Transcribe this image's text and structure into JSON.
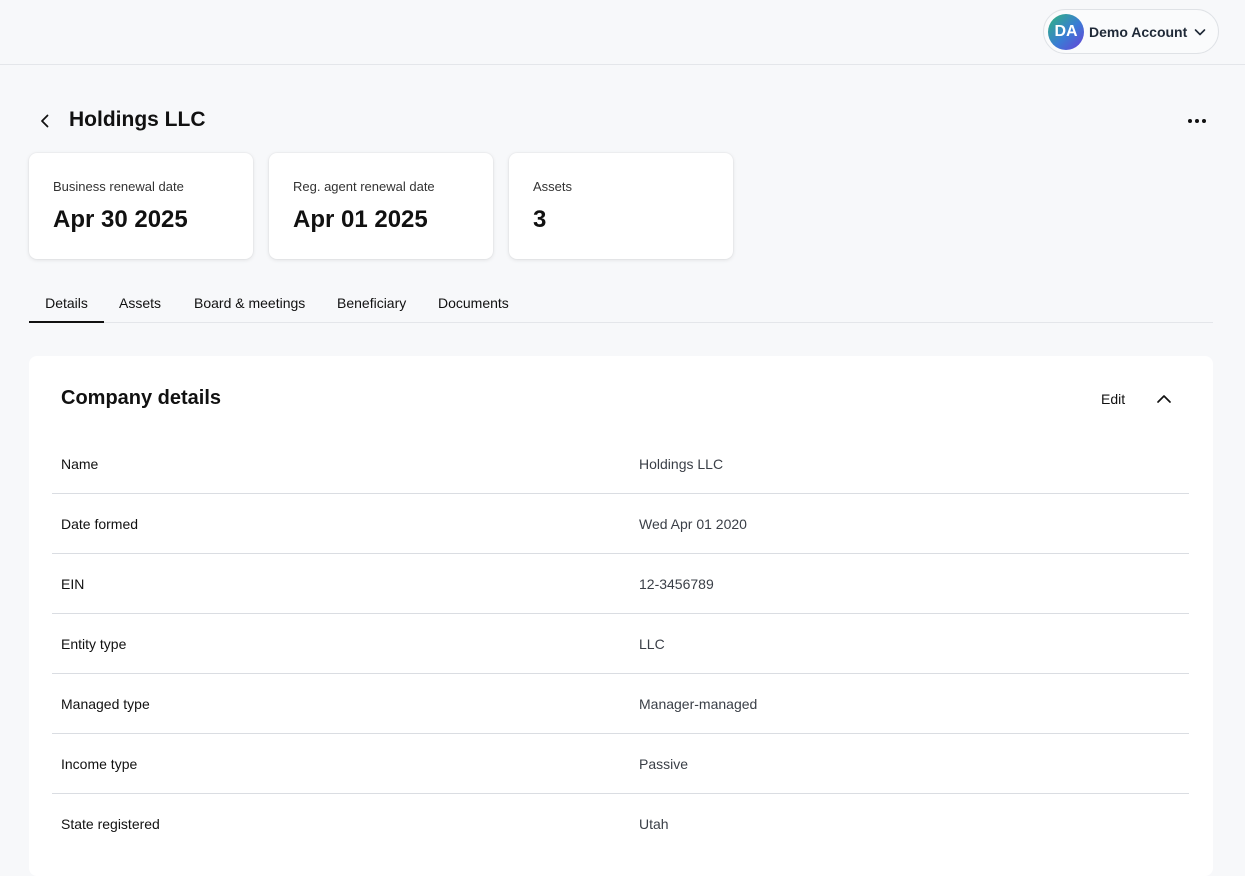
{
  "account": {
    "initials": "DA",
    "name": "Demo Account"
  },
  "page": {
    "title": "Holdings LLC"
  },
  "summary_cards": [
    {
      "label": "Business renewal date",
      "value": "Apr 30 2025"
    },
    {
      "label": "Reg. agent renewal date",
      "value": "Apr 01 2025"
    },
    {
      "label": "Assets",
      "value": "3"
    }
  ],
  "tabs": [
    {
      "label": "Details",
      "active": true
    },
    {
      "label": "Assets"
    },
    {
      "label": "Board & meetings"
    },
    {
      "label": "Beneficiary"
    },
    {
      "label": "Documents"
    }
  ],
  "details_panel": {
    "title": "Company details",
    "edit_label": "Edit",
    "rows": [
      {
        "label": "Name",
        "value": "Holdings LLC"
      },
      {
        "label": "Date formed",
        "value": "Wed Apr 01 2020"
      },
      {
        "label": "EIN",
        "value": "12-3456789"
      },
      {
        "label": "Entity type",
        "value": "LLC"
      },
      {
        "label": "Managed type",
        "value": "Manager-managed"
      },
      {
        "label": "Income type",
        "value": "Passive"
      },
      {
        "label": "State registered",
        "value": "Utah"
      }
    ]
  }
}
